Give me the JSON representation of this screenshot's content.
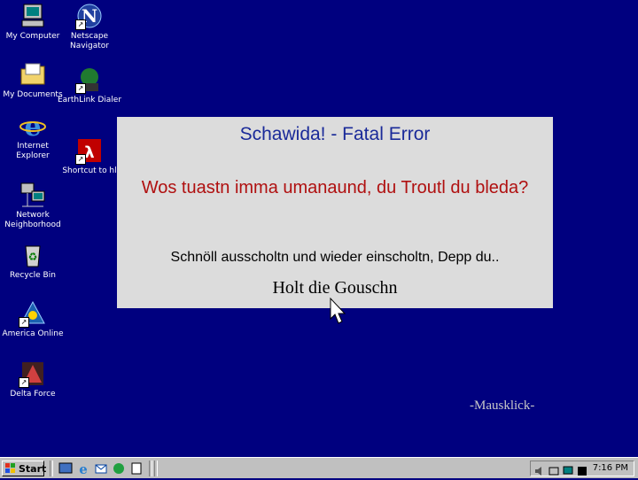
{
  "desktop": {
    "icons": [
      {
        "label": "My Computer"
      },
      {
        "label": "Netscape Navigator"
      },
      {
        "label": "My Documents"
      },
      {
        "label": "EarthLink Dialer"
      },
      {
        "label": "Internet Explorer"
      },
      {
        "label": "Shortcut to hl"
      },
      {
        "label": "Network Neighborhood"
      },
      {
        "label": "Recycle Bin"
      },
      {
        "label": "America Online"
      },
      {
        "label": "Delta Force"
      }
    ]
  },
  "dialog": {
    "title": "Schawida! - Fatal Error",
    "message": "Wos tuastn imma umanaund, du Troutl du bleda?",
    "subtext": "Schnöll ausscholtn und wieder einscholtn, Depp du..",
    "button": "Holt die Gouschn"
  },
  "hint": "-Mausklick-",
  "taskbar": {
    "start_label": "Start",
    "clock": "7:16 PM"
  },
  "colors": {
    "desktop": "#00007f",
    "dialog_bg": "#dcdcdc",
    "title": "#1a2a99",
    "message": "#b01010"
  }
}
